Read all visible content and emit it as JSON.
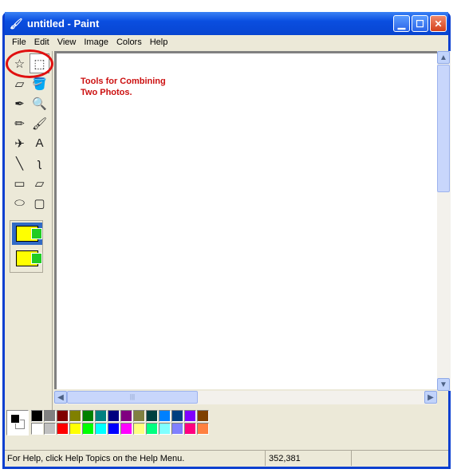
{
  "window": {
    "title": "untitled - Paint",
    "icons": [
      "paint-app-icon",
      "minimize-icon",
      "maximize-icon",
      "close-icon"
    ]
  },
  "menu": [
    "File",
    "Edit",
    "View",
    "Image",
    "Colors",
    "Help"
  ],
  "tools": [
    {
      "name": "free-form-select",
      "glyph": "☆"
    },
    {
      "name": "select",
      "glyph": "⬚"
    },
    {
      "name": "eraser",
      "glyph": "▱"
    },
    {
      "name": "fill-with-color",
      "glyph": "🪣"
    },
    {
      "name": "pick-color",
      "glyph": "✒"
    },
    {
      "name": "magnifier",
      "glyph": "🔍"
    },
    {
      "name": "pencil",
      "glyph": "✏"
    },
    {
      "name": "brush",
      "glyph": "🖌"
    },
    {
      "name": "airbrush",
      "glyph": "✈"
    },
    {
      "name": "text",
      "glyph": "A"
    },
    {
      "name": "line",
      "glyph": "╲"
    },
    {
      "name": "curve",
      "glyph": "ʅ"
    },
    {
      "name": "rectangle",
      "glyph": "▭"
    },
    {
      "name": "polygon",
      "glyph": "⏥"
    },
    {
      "name": "ellipse",
      "glyph": "⬭"
    },
    {
      "name": "rounded-rectangle",
      "glyph": "▢"
    }
  ],
  "selected_tool": "select",
  "annotation": {
    "line1": "Tools for Combining",
    "line2": "Two Photos.",
    "color": "#cc1010"
  },
  "palette": {
    "foreground": "#000000",
    "background": "#ffffff",
    "top": [
      "#000000",
      "#808080",
      "#800000",
      "#808000",
      "#008000",
      "#008080",
      "#000080",
      "#800080",
      "#808040",
      "#004040",
      "#0080ff",
      "#004080",
      "#8000ff",
      "#804000"
    ],
    "bottom": [
      "#ffffff",
      "#c0c0c0",
      "#ff0000",
      "#ffff00",
      "#00ff00",
      "#00ffff",
      "#0000ff",
      "#ff00ff",
      "#ffff80",
      "#00ff80",
      "#80ffff",
      "#8080ff",
      "#ff0080",
      "#ff8040"
    ]
  },
  "status": {
    "help": "For Help, click Help Topics on the Help Menu.",
    "coords": "352,381"
  }
}
